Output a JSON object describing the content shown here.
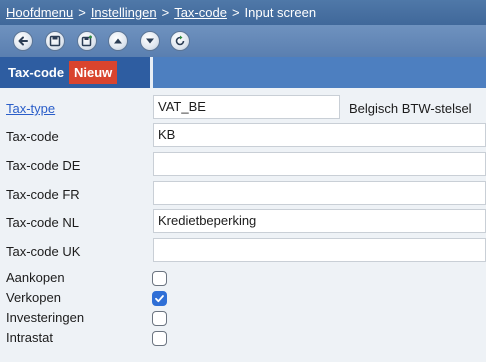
{
  "breadcrumb": {
    "items": [
      "Hoofdmenu",
      "Instellingen",
      "Tax-code",
      "Input screen"
    ],
    "separator": ">"
  },
  "toolbar": {
    "buttons": [
      "back-icon",
      "save-icon",
      "save-new-icon",
      "up-icon",
      "down-icon",
      "refresh-icon"
    ]
  },
  "tab": {
    "title": "Tax-code",
    "badge": "Nieuw",
    "badge_color": "#d9442e"
  },
  "form": {
    "tax_type": {
      "label": "Tax-type",
      "value": "VAT_BE",
      "description": "Belgisch BTW-stelsel"
    },
    "tax_code": {
      "label": "Tax-code",
      "value": "KB"
    },
    "tax_code_de": {
      "label": "Tax-code DE",
      "value": ""
    },
    "tax_code_fr": {
      "label": "Tax-code FR",
      "value": ""
    },
    "tax_code_nl": {
      "label": "Tax-code NL",
      "value": "Kredietbeperking"
    },
    "tax_code_uk": {
      "label": "Tax-code UK",
      "value": ""
    },
    "checkboxes": [
      {
        "label": "Aankopen",
        "checked": false
      },
      {
        "label": "Verkopen",
        "checked": true
      },
      {
        "label": "Investeringen",
        "checked": false
      },
      {
        "label": "Intrastat",
        "checked": false
      }
    ]
  },
  "colors": {
    "accent": "#2f6fd6",
    "header": "#4f78a8",
    "tab_bar": "#4d7fc0",
    "link": "#2a5ec9"
  }
}
